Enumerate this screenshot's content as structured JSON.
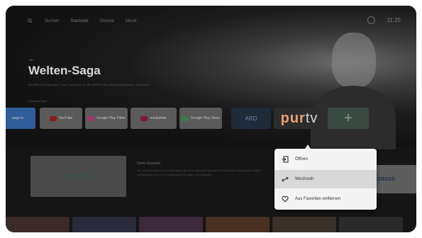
{
  "nav": {
    "items": [
      "Suchen",
      "Startseite",
      "Dienste",
      "Musik"
    ],
    "active_index": 1,
    "time": "11:25"
  },
  "hero": {
    "back": "←",
    "title": "Welten-Saga",
    "description": "Ein Film in 12 Episoden: 1 und 2 zu sehen, 3 - 4K HDR PG-13 | Wissenschaftsfiction, Abenteuer"
  },
  "apps": {
    "section_label": "Lieblings-Apps",
    "items": [
      {
        "label": "ange.tv",
        "color": "#2f5d9a"
      },
      {
        "label": "YouTube",
        "color": "#5a5a5a"
      },
      {
        "label": "Google Play Filme",
        "color": "#5a5a5a"
      },
      {
        "label": "mediathek",
        "color": "#5a5a5a"
      },
      {
        "label": "Google Play Store",
        "color": "#5a5a5a"
      },
      {
        "label": "ARD",
        "color": "#1f2a3a"
      }
    ],
    "purtv_prefix": "pur",
    "purtv_suffix": "tv",
    "add_label": "+"
  },
  "row2": {
    "tile_label": "FUSSBALL",
    "info_title": "Deine Auswahl",
    "info_body": "Hier werden Inhalte von Diensten angezeigt, die du abonniert hast oder für die du einen Zugang hast. Weitere Dienste kannst du in den Einstellungen hinzufügen oder entfernen.",
    "right_tile_label": "CROSS"
  },
  "context_menu": {
    "items": [
      {
        "label": "Öffnen",
        "icon": "open-icon"
      },
      {
        "label": "Wechseln",
        "icon": "swap-icon"
      },
      {
        "label": "Aus Favoriten entfernen",
        "icon": "heart-icon"
      }
    ],
    "selected_index": 1
  }
}
